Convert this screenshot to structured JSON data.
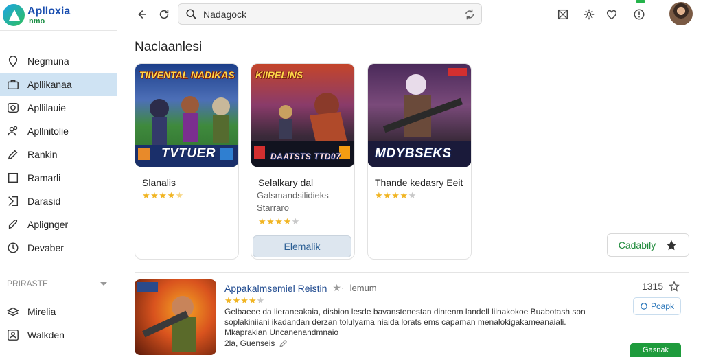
{
  "app": {
    "logo_line1": "Aplloxia",
    "logo_line2": "nmo"
  },
  "search": {
    "value": "Nadagock",
    "placeholder": ""
  },
  "sidebar": {
    "items": [
      {
        "label": "Negmuna",
        "icon": "map-pin-icon"
      },
      {
        "label": "Apllikanaa",
        "icon": "briefcase-icon",
        "active": true
      },
      {
        "label": "Apllilauie",
        "icon": "camera-icon"
      },
      {
        "label": "Apllnitolie",
        "icon": "people-icon"
      },
      {
        "label": "Rankin",
        "icon": "pencil-icon"
      },
      {
        "label": "Ramarli",
        "icon": "square-icon"
      },
      {
        "label": "Darasid",
        "icon": "bookmark-icon"
      },
      {
        "label": "Aplignger",
        "icon": "rocket-icon"
      },
      {
        "label": "Devaber",
        "icon": "clock-icon"
      }
    ],
    "section_title": "PRIRASTE",
    "section_items": [
      {
        "label": "Mirelia",
        "icon": "layers-icon"
      },
      {
        "label": "Walkden",
        "icon": "account-icon"
      }
    ]
  },
  "main": {
    "title": "Naclaanlesi",
    "cards": [
      {
        "thumb_banner": "TIIVENTAL NADIKAS",
        "thumb_title": "TVTUER",
        "name": "Slanalis",
        "sub1": "",
        "sub2": "",
        "rating": 4.5,
        "button": ""
      },
      {
        "thumb_banner": "KIIRELINS",
        "thumb_title": "DAATSTS TTD07",
        "name": "Selalkary dal",
        "sub1": "Galsmandsilidieks",
        "sub2": "Starraro",
        "rating": 4,
        "button": "Elemalik"
      },
      {
        "thumb_banner": "",
        "thumb_title": "MDYBSEKS",
        "name": "Thande kedasry Eeit",
        "sub1": "",
        "sub2": "",
        "rating": 4,
        "button": ""
      }
    ],
    "capability_button": "Cadabily"
  },
  "detail": {
    "title": "Appakalmsemiel Reistin",
    "meta": "lemum",
    "rating": 4,
    "description": "Gelbaeee da lieraneakaia, disbion lesde bavanstenestan dintenm landell lilnakokoe Buabotash son soplakiniiani ikadandan derzan tolulyama niaida lorats ems capaman menalokigakameanaiali. Mkaprakian Uncanenandmnaio",
    "author": "2la, Guenseis",
    "count": "1315",
    "popular_label": "Poapk",
    "get_label": "Gasnak"
  },
  "colors": {
    "accent": "#1b4fb0",
    "active_nav": "#cfe3f3",
    "star": "#f1b523",
    "green": "#1e9b3c"
  }
}
